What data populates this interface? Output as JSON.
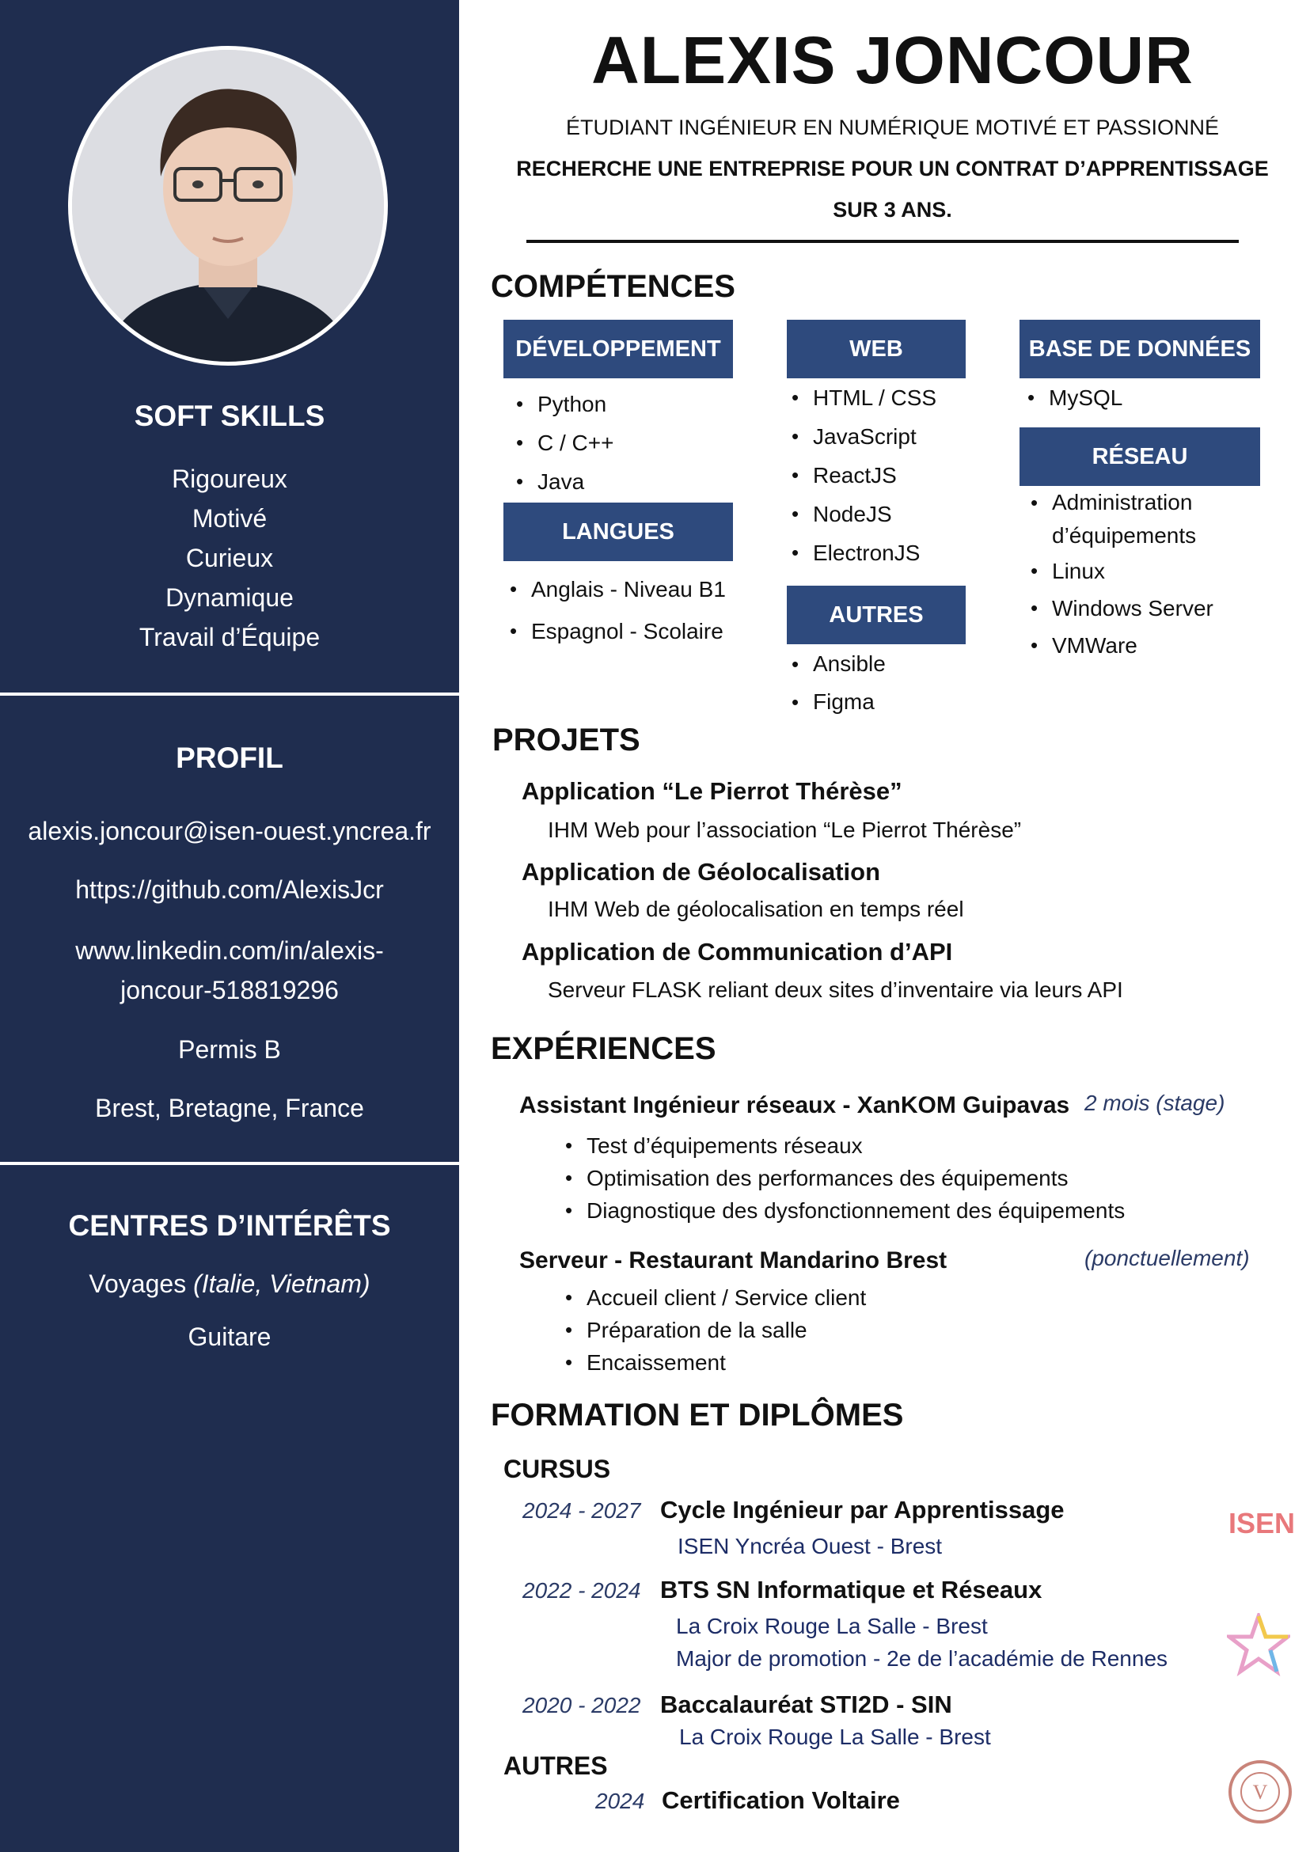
{
  "header": {
    "name": "ALEXIS JONCOUR",
    "tagline_1": "ÉTUDIANT INGÉNIEUR EN NUMÉRIQUE MOTIVÉ ET PASSIONNÉ",
    "tagline_2": "RECHERCHE UNE ENTREPRISE POUR UN CONTRAT D’APPRENTISSAGE",
    "tagline_3": "SUR 3 ANS."
  },
  "sidebar": {
    "soft_skills_title": "SOFT SKILLS",
    "soft_skills": [
      "Rigoureux",
      "Motivé",
      "Curieux",
      "Dynamique",
      "Travail d’Équipe"
    ],
    "profil_title": "PROFIL",
    "email": "alexis.joncour@isen-ouest.yncrea.fr",
    "github": "https://github.com/AlexisJcr",
    "linkedin_1": "www.linkedin.com/in/alexis-",
    "linkedin_2": "joncour-518819296",
    "permis": "Permis B",
    "location": "Brest, Bretagne, France",
    "interests_title": "CENTRES D’INTÉRÊTS",
    "voyages": "Voyages",
    "voyages_detail": "(Italie, Vietnam)",
    "guitare": "Guitare"
  },
  "competences": {
    "title": "COMPÉTENCES",
    "dev": {
      "label": "DÉVELOPPEMENT",
      "items": [
        "Python",
        "C / C++",
        "Java"
      ]
    },
    "langues": {
      "label": "LANGUES",
      "items": [
        "Anglais - Niveau B1",
        "Espagnol - Scolaire"
      ]
    },
    "web": {
      "label": "WEB",
      "items": [
        "HTML / CSS",
        "JavaScript",
        "ReactJS",
        "NodeJS",
        "ElectronJS"
      ]
    },
    "autres": {
      "label": "AUTRES",
      "items": [
        "Ansible",
        "Figma"
      ]
    },
    "bdd": {
      "label": "BASE DE DONNÉES",
      "items": [
        "MySQL"
      ]
    },
    "reseau": {
      "label": "RÉSEAU",
      "items": [
        "Administration",
        "d’équipements",
        "Linux",
        "Windows Server",
        "VMWare"
      ]
    }
  },
  "projets": {
    "title": "PROJETS",
    "items": [
      {
        "title": "Application “Le Pierrot Thérèse”",
        "desc": "IHM Web pour l’association “Le Pierrot Thérèse”"
      },
      {
        "title": "Application de Géolocalisation",
        "desc": "IHM Web de géolocalisation en temps réel"
      },
      {
        "title": "Application de Communication d’API",
        "desc": "Serveur FLASK reliant deux sites d’inventaire via leurs API"
      }
    ]
  },
  "experiences": {
    "title": "EXPÉRIENCES",
    "items": [
      {
        "title": "Assistant Ingénieur réseaux - XanKOM Guipavas",
        "period": "2 mois (stage)",
        "tasks": [
          "Test d’équipements réseaux",
          "Optimisation des performances des équipements",
          "Diagnostique des dysfonctionnement des équipements"
        ]
      },
      {
        "title": "Serveur - Restaurant Mandarino Brest",
        "period": "(ponctuellement)",
        "tasks": [
          "Accueil client / Service client",
          "Préparation de la salle",
          "Encaissement"
        ]
      }
    ]
  },
  "formation": {
    "title": "FORMATION ET DIPLÔMES",
    "cursus_label": "CURSUS",
    "items": [
      {
        "years": "2024 - 2027",
        "degree": "Cycle Ingénieur par Apprentissage",
        "lines": [
          "ISEN Yncréa Ouest - Brest"
        ]
      },
      {
        "years": "2022 - 2024",
        "degree": "BTS SN Informatique et Réseaux",
        "lines": [
          "La Croix Rouge La Salle - Brest",
          "Major de promotion - 2e de l’académie de Rennes"
        ]
      },
      {
        "years": "2020 - 2022",
        "degree": "Baccalauréat STI2D - SIN",
        "lines": [
          "La Croix Rouge La Salle - Brest"
        ]
      }
    ],
    "autres_label": "AUTRES",
    "cert_year": "2024",
    "cert_name": "Certification Voltaire",
    "isen_logo": "ISEN",
    "voltaire_seal": "CERTIFICATION VOLTAIRE"
  },
  "colors": {
    "sidebar": "#1f2d4f",
    "category": "#2e4a7d",
    "accent_text": "#2a3a66",
    "isen": "#e8787b"
  }
}
